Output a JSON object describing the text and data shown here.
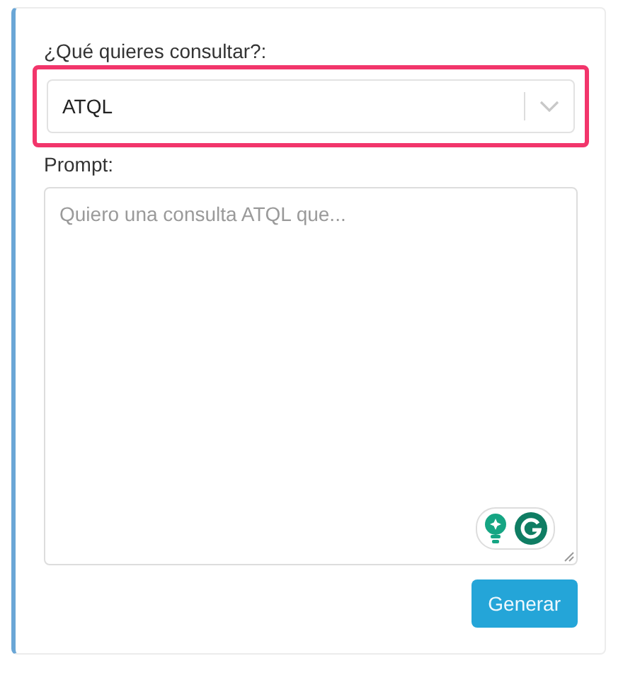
{
  "form": {
    "select_label": "¿Qué quieres consultar?:",
    "select_value": "ATQL",
    "highlighted": true,
    "prompt_label": "Prompt:",
    "prompt_placeholder": "Quiero una consulta ATQL que...",
    "submit_button": "Generar"
  }
}
